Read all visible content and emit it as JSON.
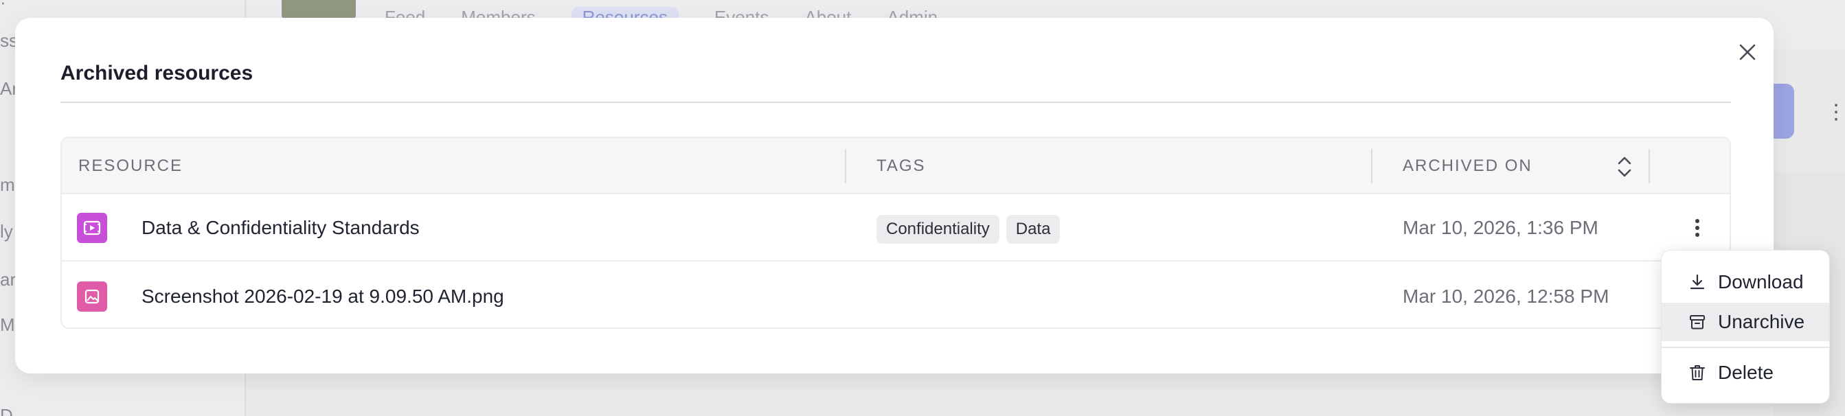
{
  "background": {
    "sidebar_fragments": [
      "ss",
      "An",
      "mb",
      "ly",
      "ar",
      "M",
      "D"
    ],
    "tabs": [
      "Feed",
      "Members",
      "Resources",
      "Events",
      "About",
      "Admin"
    ]
  },
  "modal": {
    "title": "Archived resources",
    "columns": {
      "resource": "RESOURCE",
      "tags": "TAGS",
      "archived_on": "ARCHIVED ON"
    },
    "rows": [
      {
        "name": "Data & Confidentiality Standards",
        "icon": "video-file-icon",
        "icon_color": "#c84fd8",
        "tags": [
          "Confidentiality",
          "Data"
        ],
        "archived_on": "Mar 10, 2026, 1:36 PM"
      },
      {
        "name": "Screenshot 2026-02-19 at 9.09.50 AM.png",
        "icon": "image-file-icon",
        "icon_color": "#e05ca6",
        "tags": [],
        "archived_on": "Mar 10, 2026, 12:58 PM"
      }
    ]
  },
  "menu": {
    "items": [
      "Download",
      "Unarchive",
      "Delete"
    ]
  },
  "colors": {
    "accent": "#8d97d6",
    "hover_bg": "#ececee"
  }
}
